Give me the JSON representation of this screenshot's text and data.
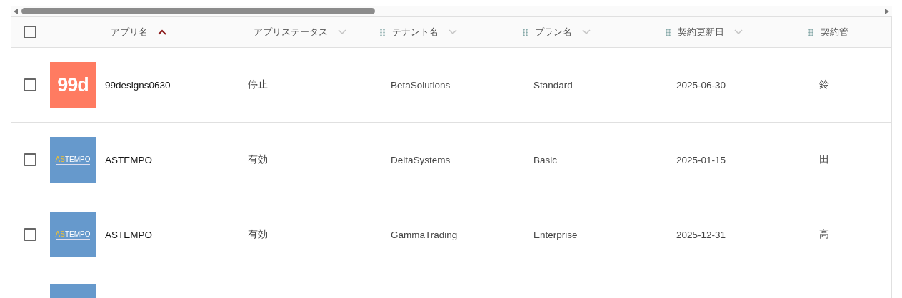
{
  "table": {
    "select_all": {
      "checked": false
    },
    "columns": [
      {
        "label": "アプリ名",
        "sorted": true,
        "draggable": false
      },
      {
        "label": "アプリステータス",
        "sorted": false,
        "draggable": false
      },
      {
        "label": "テナント名",
        "sorted": false,
        "draggable": true
      },
      {
        "label": "プラン名",
        "sorted": false,
        "draggable": true
      },
      {
        "label": "契約更新日",
        "sorted": false,
        "draggable": true
      },
      {
        "label": "契約管",
        "draggable": true
      }
    ],
    "rows": [
      {
        "checked": false,
        "logo": {
          "kind": "monogram",
          "parts": [
            "99d"
          ]
        },
        "cells": [
          "99designs0630",
          "停止",
          "BetaSolutions",
          "Standard",
          "2025-06-30",
          "鈴"
        ]
      },
      {
        "checked": false,
        "logo": {
          "kind": "wordmark",
          "parts": [
            "AS",
            "TEMPO"
          ]
        },
        "cells": [
          "ASTEMPO",
          "有効",
          "DeltaSystems",
          "Basic",
          "2025-01-15",
          "田"
        ]
      },
      {
        "checked": false,
        "logo": {
          "kind": "wordmark",
          "parts": [
            "AS",
            "TEMPO"
          ]
        },
        "cells": [
          "ASTEMPO",
          "有効",
          "GammaTrading",
          "Enterprise",
          "2025-12-31",
          "高"
        ]
      },
      {
        "logo": {
          "kind": "plain"
        }
      }
    ]
  }
}
